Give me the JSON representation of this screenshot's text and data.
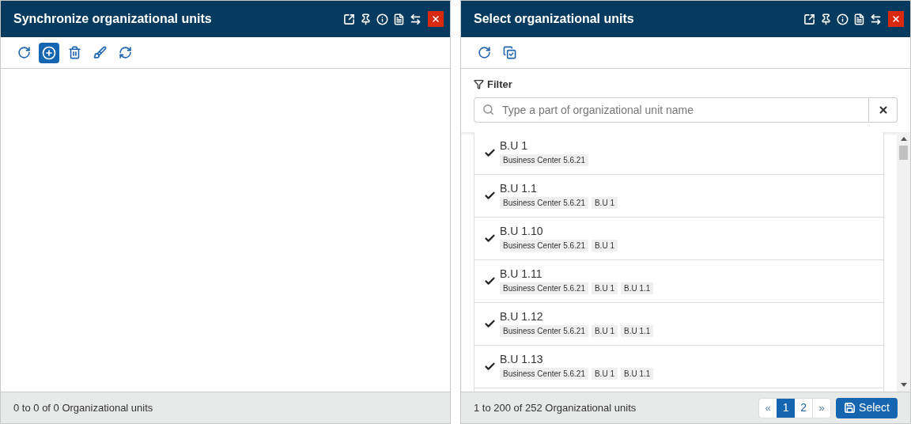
{
  "panels": [
    {
      "title": "Synchronize organizational units",
      "toolbar": [
        {
          "kind": "refresh",
          "selected": false
        },
        {
          "kind": "add",
          "selected": true
        },
        {
          "kind": "delete",
          "selected": false
        },
        {
          "kind": "clean",
          "selected": false
        },
        {
          "kind": "sync",
          "selected": false
        }
      ],
      "footer": "0 to 0 of 0 Organizational units"
    },
    {
      "title": "Select organizational units",
      "toolbar": [
        {
          "kind": "refresh",
          "selected": false
        },
        {
          "kind": "select-all",
          "selected": false
        }
      ],
      "filter": {
        "label": "Filter",
        "placeholder": "Type a part of organizational unit name"
      },
      "items": [
        {
          "name": "B.U 1",
          "checked": true,
          "path": [
            "Business Center 5.6.21"
          ]
        },
        {
          "name": "B.U 1.1",
          "checked": true,
          "path": [
            "Business Center 5.6.21",
            "B.U 1"
          ]
        },
        {
          "name": "B.U 1.10",
          "checked": true,
          "path": [
            "Business Center 5.6.21",
            "B.U 1"
          ]
        },
        {
          "name": "B.U 1.11",
          "checked": true,
          "path": [
            "Business Center 5.6.21",
            "B.U 1",
            "B.U 1.1"
          ]
        },
        {
          "name": "B.U 1.12",
          "checked": true,
          "path": [
            "Business Center 5.6.21",
            "B.U 1",
            "B.U 1.1"
          ]
        },
        {
          "name": "B.U 1.13",
          "checked": true,
          "path": [
            "Business Center 5.6.21",
            "B.U 1",
            "B.U 1.1"
          ]
        }
      ],
      "footer": "1 to 200 of 252 Organizational units",
      "pagination": {
        "prev": "«",
        "next": "»",
        "pages": [
          {
            "label": "1",
            "selected": true
          },
          {
            "label": "2",
            "selected": false
          }
        ]
      },
      "select_button": "Select"
    }
  ]
}
